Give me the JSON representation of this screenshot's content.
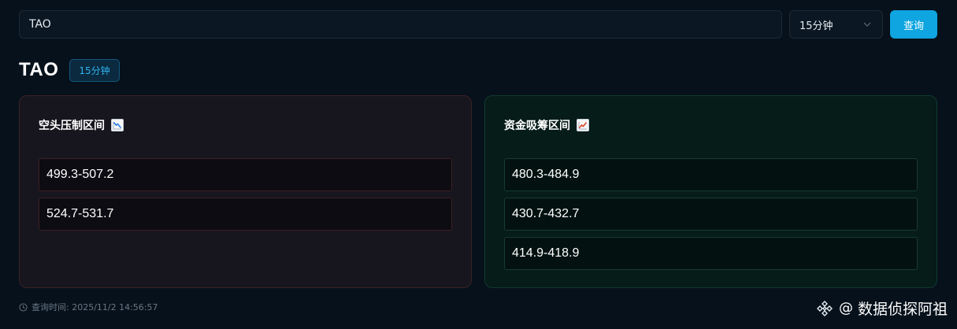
{
  "search": {
    "value": "TAO",
    "interval_selected": "15分钟",
    "query_label": "查询"
  },
  "header": {
    "title": "TAO",
    "interval_badge": "15分钟"
  },
  "resistance": {
    "title": "空头压制区间",
    "icon": "chart-decreasing-icon",
    "ranges": [
      "499.3-507.2",
      "524.7-531.7"
    ]
  },
  "support": {
    "title": "资金吸筹区间",
    "icon": "chart-increasing-icon",
    "ranges": [
      "480.3-484.9",
      "430.7-432.7",
      "414.9-418.9"
    ]
  },
  "footer": {
    "query_time": "查询时间: 2025/11/2 14:56:57"
  },
  "watermark": {
    "at": "@",
    "text": "数据侦探阿祖"
  },
  "colors": {
    "accent": "#0ea5e0",
    "badge_text": "#2fb4ef",
    "resistance_border": "#3a2126",
    "support_border": "#113a30",
    "background": "#06111b"
  }
}
